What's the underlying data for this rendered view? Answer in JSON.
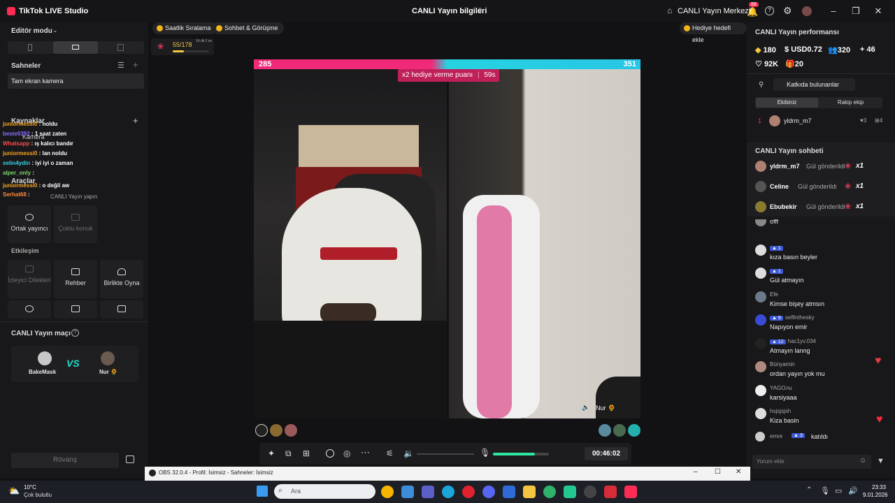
{
  "app": {
    "title": "TikTok LIVE Studio",
    "window_title": "CANLI Yayın bilgileri",
    "center_link": "CANLI Yayın Merkezi",
    "notif_count": "88"
  },
  "left": {
    "editor_mode": "Editör modu",
    "scenes_title": "Sahneler",
    "scene_item": "Tam ekran kamera",
    "sources_title": "Kaynaklar",
    "tools_title": "Araçlar",
    "tools_hint": "CANLI Yayın yapın",
    "tools": {
      "co_host": "Ortak yayıncı",
      "multi_guest": "Çoklu konuk"
    },
    "interaction_title": "Etkileşim",
    "interaction": {
      "viewer_wishes": "İzleyici Dilekleri",
      "guide": "Rehber",
      "play_together": "Birlikte Oyna"
    },
    "match_title": "CANLI Yayın maçı",
    "match": {
      "left_name": "BakeMask",
      "vs": "VS",
      "right_name": "Nur 🌻"
    },
    "rematch": "Rövanş",
    "overlay_chat": [
      {
        "user": "juniormessi0",
        "msg": ": noldu",
        "color": "#f5a623"
      },
      {
        "user": "beste0392",
        "msg": ": 1 saat zaten",
        "color": "#8b6cff"
      },
      {
        "user": "Whatsapp",
        "msg": ": ış kalıcı bandır",
        "color": "#ff4a4a"
      },
      {
        "user": "juniormessi0",
        "msg": ": lan noldu",
        "color": "#f5a623"
      },
      {
        "user": "selin4ydin",
        "msg": ": iyi iyi o zaman",
        "color": "#35d3e6"
      },
      {
        "user": "alper_only",
        "msg": ":",
        "color": "#7ad66b"
      },
      {
        "user": "juniormessi0",
        "msg": ": o değil aw",
        "color": "#f5a623"
      },
      {
        "user": "Serhat68",
        "msg": ":",
        "color": "#ff8a3d"
      }
    ],
    "overlay_kamera": "Kamera"
  },
  "center": {
    "pill1": "Saatlik Sıralama",
    "pill2": "Sohbet & Görüşme",
    "gift_goal": "Hediye hedefi ekle",
    "gift_progress": "55/178",
    "gift_timer": "14 dk 2 sn",
    "gift_fill": 0.31,
    "score_left": "285",
    "score_right": "351",
    "battle_banner": "x2 hediye verme puanı",
    "battle_time": "59s",
    "opponent_label": "Nur 🌻",
    "timer": "00:46:02",
    "mic_level": 0.75
  },
  "right": {
    "perf_title": "CANLI Yayın performansı",
    "stats": {
      "coins": "180",
      "usd": "USD0.72",
      "viewers": "320",
      "new": "46",
      "likes": "92K",
      "gifts": "20"
    },
    "contributors_btn": "Katkıda bulunanlar",
    "tab_team": "Ekibiniz",
    "tab_rival": "Rakip ekip",
    "leader": {
      "rank": "1",
      "name": "yldrm_m7",
      "likes": "3",
      "gifts": "4"
    },
    "chat_title": "CANLI Yayın sohbeti",
    "gifts": [
      {
        "name": "yldrm_m7",
        "action": "Gül gönderildi",
        "count": "x1"
      },
      {
        "name": "Celine",
        "action": "Gül gönderildi",
        "count": "x1"
      },
      {
        "name": "Ebubekir",
        "action": "Gül gönderildi",
        "count": "x1"
      }
    ],
    "messages": [
      {
        "name": "",
        "badge": "",
        "text": "offf"
      },
      {
        "name": "",
        "badge": "1",
        "text": "kıza basın beyler"
      },
      {
        "name": "",
        "badge": "1",
        "text": "Gül atmayın"
      },
      {
        "name": "Efe",
        "badge": "",
        "text": "Kimse bişey atmsın"
      },
      {
        "name": "selfinthesky",
        "badge": "9",
        "text": "Napıyon emir"
      },
      {
        "name": "hac1yv.034",
        "badge": "12",
        "text": "Atmayın lanng"
      },
      {
        "name": "Bünyamin",
        "badge": "",
        "text": "ordan yayın yok mu"
      },
      {
        "name": "YAGOлu",
        "badge": "",
        "text": "karsiyaaa"
      },
      {
        "name": "hsjsjsjsh",
        "badge": "",
        "text": "Kiza basin"
      }
    ],
    "joined": {
      "name": "emre",
      "badge": "3",
      "text": "katıldı"
    },
    "comment_placeholder": "Yorum ekle"
  },
  "obs": {
    "title": "OBS 32.0.4 - Profil: İsimsiz - Sahneler: İsimsiz"
  },
  "taskbar": {
    "weather_temp": "10°C",
    "weather_desc": "Çok bulutlu",
    "search": "Ara",
    "time": "23:33",
    "date": "9.01.2026"
  }
}
